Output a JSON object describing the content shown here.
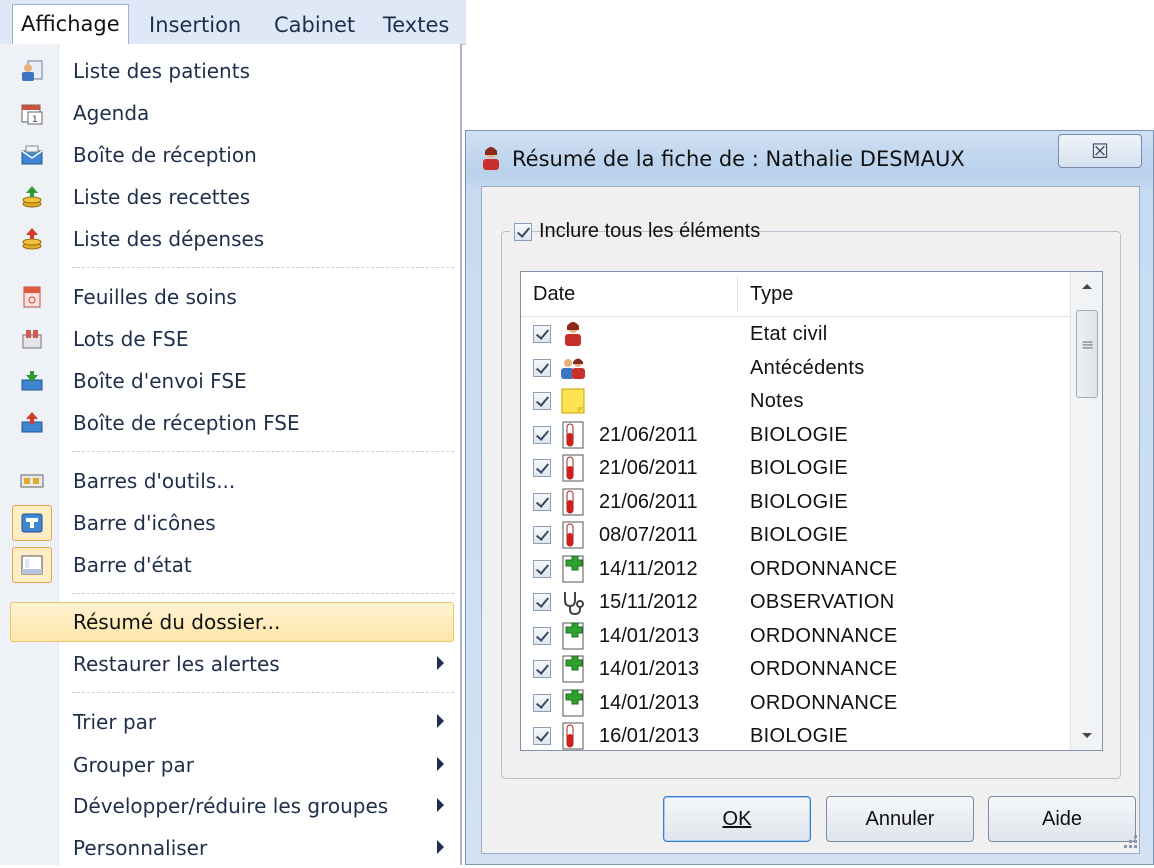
{
  "menubar": {
    "items": [
      {
        "label": "Affichage",
        "active": true
      },
      {
        "label": "Insertion"
      },
      {
        "label": "Cabinet"
      },
      {
        "label": "Textes"
      }
    ]
  },
  "menu": {
    "items": [
      {
        "label": "Liste des patients",
        "icon": "patients-list-icon"
      },
      {
        "label": "Agenda",
        "icon": "calendar-icon"
      },
      {
        "label": "Boîte de réception",
        "icon": "inbox-icon"
      },
      {
        "label": "Liste des recettes",
        "icon": "income-coins-icon"
      },
      {
        "label": "Liste des dépenses",
        "icon": "expense-coins-icon"
      },
      {
        "label": "Feuilles de soins",
        "icon": "care-sheet-icon"
      },
      {
        "label": "Lots de FSE",
        "icon": "fse-batch-icon"
      },
      {
        "label": "Boîte d'envoi FSE",
        "icon": "fse-outbox-icon"
      },
      {
        "label": "Boîte de réception FSE",
        "icon": "fse-inbox-icon"
      },
      {
        "label": "Barres d'outils...",
        "icon": "toolbars-icon"
      },
      {
        "label": "Barre d'icônes",
        "icon": "icon-bar-icon",
        "checked": true
      },
      {
        "label": "Barre d'état",
        "icon": "status-bar-icon",
        "checked": true
      },
      {
        "label": "Résumé du dossier...",
        "highlighted": true
      },
      {
        "label": "Restaurer les alertes",
        "submenu": true
      },
      {
        "label": "Trier par",
        "submenu": true
      },
      {
        "label": "Grouper par",
        "submenu": true
      },
      {
        "label": "Développer/réduire les groupes",
        "submenu": true
      },
      {
        "label": "Personnaliser",
        "submenu": true
      }
    ]
  },
  "dialog": {
    "title": "Résumé de la fiche de : Nathalie DESMAUX",
    "close_glyph": "☒",
    "include_all_label": "Inclure tous les éléments",
    "columns": {
      "date": "Date",
      "type": "Type"
    },
    "rows": [
      {
        "date": "",
        "type": "Etat civil",
        "icon": "person-icon",
        "checked": true
      },
      {
        "date": "",
        "type": "Antécédents",
        "icon": "people-icon",
        "checked": true
      },
      {
        "date": "",
        "type": "Notes",
        "icon": "sticky-note-icon",
        "checked": true
      },
      {
        "date": "21/06/2011",
        "type": "BIOLOGIE",
        "icon": "test-tube-icon",
        "checked": true
      },
      {
        "date": "21/06/2011",
        "type": "BIOLOGIE",
        "icon": "test-tube-icon",
        "checked": true
      },
      {
        "date": "21/06/2011",
        "type": "BIOLOGIE",
        "icon": "test-tube-icon",
        "checked": true
      },
      {
        "date": "08/07/2011",
        "type": "BIOLOGIE",
        "icon": "test-tube-icon",
        "checked": true
      },
      {
        "date": "14/11/2012",
        "type": "ORDONNANCE",
        "icon": "prescription-cross-icon",
        "checked": true
      },
      {
        "date": "15/11/2012",
        "type": "OBSERVATION",
        "icon": "stethoscope-icon",
        "checked": true
      },
      {
        "date": "14/01/2013",
        "type": "ORDONNANCE",
        "icon": "prescription-cross-icon",
        "checked": true
      },
      {
        "date": "14/01/2013",
        "type": "ORDONNANCE",
        "icon": "prescription-cross-icon",
        "checked": true
      },
      {
        "date": "14/01/2013",
        "type": "ORDONNANCE",
        "icon": "prescription-cross-icon",
        "checked": true
      },
      {
        "date": "16/01/2013",
        "type": "BIOLOGIE",
        "icon": "test-tube-icon",
        "checked": true
      }
    ],
    "buttons": {
      "ok": "OK",
      "cancel": "Annuler",
      "help": "Aide"
    }
  }
}
